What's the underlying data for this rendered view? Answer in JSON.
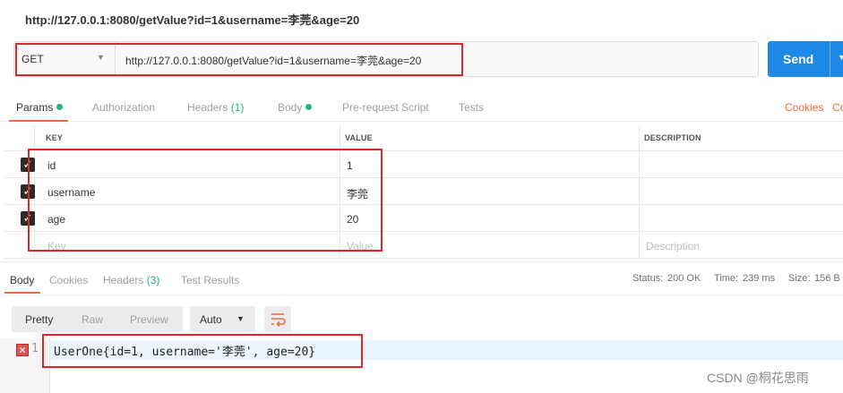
{
  "page_title": "http://127.0.0.1:8080/getValue?id=1&username=李莞&age=20",
  "request": {
    "method": "GET",
    "url": "http://127.0.0.1:8080/getValue?id=1&username=李莞&age=20",
    "send_label": "Send"
  },
  "request_tabs": {
    "params": "Params",
    "authorization": "Authorization",
    "headers": "Headers",
    "headers_count": "(1)",
    "body": "Body",
    "pre_request": "Pre-request Script",
    "tests": "Tests",
    "cookies": "Cookies",
    "code_cut": "Co"
  },
  "params_table": {
    "headers": {
      "key": "KEY",
      "value": "VALUE",
      "description": "DESCRIPTION"
    },
    "rows": [
      {
        "key": "id",
        "value": "1",
        "checked": true
      },
      {
        "key": "username",
        "value": "李莞",
        "checked": true
      },
      {
        "key": "age",
        "value": "20",
        "checked": true
      }
    ],
    "placeholders": {
      "key": "Key",
      "value": "Value",
      "description": "Description"
    }
  },
  "response_tabs": {
    "body": "Body",
    "cookies": "Cookies",
    "headers": "Headers",
    "headers_count": "(3)",
    "test_results": "Test Results"
  },
  "response_status": {
    "status_label": "Status:",
    "status_value": "200 OK",
    "time_label": "Time:",
    "time_value": "239 ms",
    "size_label": "Size:",
    "size_value": "156 B"
  },
  "view_modes": {
    "pretty": "Pretty",
    "raw": "Raw",
    "preview": "Preview",
    "auto": "Auto"
  },
  "response_body": {
    "line_number": "1",
    "content": "UserOne{id=1, username='李莞', age=20}"
  },
  "watermark": "CSDN @桐花思雨",
  "colors": {
    "accent": "#f26b3a",
    "send": "#1e88e5",
    "success": "#26b47f",
    "annotation": "#e0262d"
  }
}
